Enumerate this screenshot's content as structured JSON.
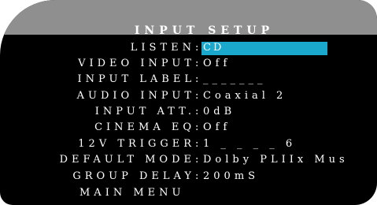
{
  "title": "INPUT SETUP",
  "items": [
    {
      "label": "LISTEN",
      "value": "CD"
    },
    {
      "label": "VIDEO INPUT",
      "value": "Off"
    },
    {
      "label": "INPUT LABEL",
      "value": "_______"
    },
    {
      "label": "AUDIO INPUT",
      "value": "Coaxial 2"
    },
    {
      "label": "INPUT ATT.",
      "value": " 0dB"
    },
    {
      "label": "CINEMA EQ",
      "value": "Off"
    },
    {
      "label": "12V TRIGGER",
      "value": "1 _ _ _ _ 6"
    },
    {
      "label": "DEFAULT MODE",
      "value": "Dolby PLIIx Mus"
    },
    {
      "label": "GROUP DELAY",
      "value": "200mS"
    }
  ],
  "main_menu_label": "MAIN MENU",
  "colors": {
    "highlight": "#1aa8cc",
    "title_bar": "#8f8f8f",
    "background": "#000000",
    "text": "#ffffff"
  }
}
